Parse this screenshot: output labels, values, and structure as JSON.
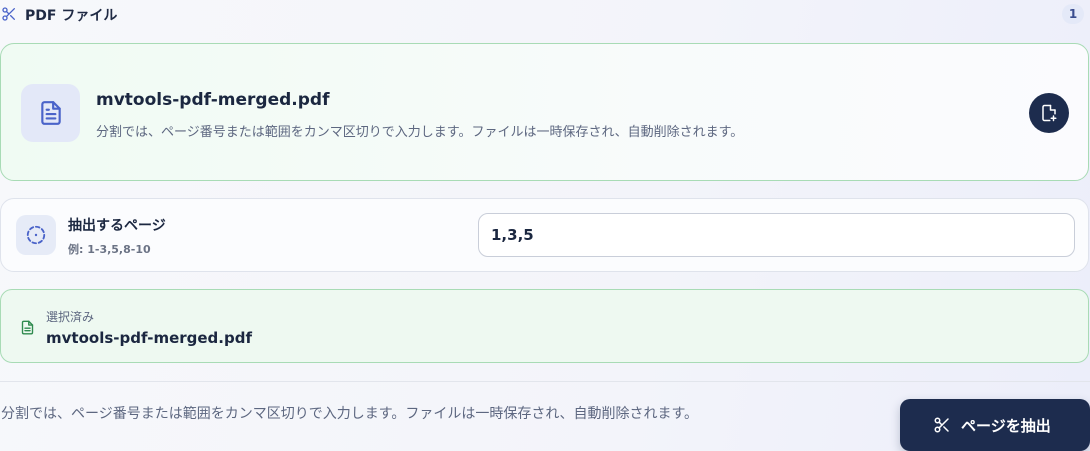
{
  "header": {
    "title": "PDF ファイル",
    "count_badge": "1",
    "icon": "scissors-icon"
  },
  "file_card": {
    "icon": "file-text-icon",
    "file_name": "mvtools-pdf-merged.pdf",
    "description": "分割では、ページ番号または範囲をカンマ区切りで入力します。ファイルは一時保存され、自動削除されます。",
    "replace_icon": "file-replace-icon"
  },
  "pages_field": {
    "icon": "dashed-circle-icon",
    "label": "抽出するページ",
    "hint": "例: 1-3,5,8-10",
    "value": "1,3,5"
  },
  "selected": {
    "icon": "file-text-icon",
    "label": "選択済み",
    "file_name": "mvtools-pdf-merged.pdf"
  },
  "footer": {
    "note": "分割では、ページ番号または範囲をカンマ区切りで入力します。ファイルは一時保存され、自動削除されます。",
    "extract_label": "ページを抽出",
    "extract_icon": "scissors-icon"
  },
  "colors": {
    "primary": "#1d2c4e",
    "accent_blue": "#4a63c9",
    "success_border": "#a8dbb5",
    "success_green": "#2f8a4e"
  }
}
